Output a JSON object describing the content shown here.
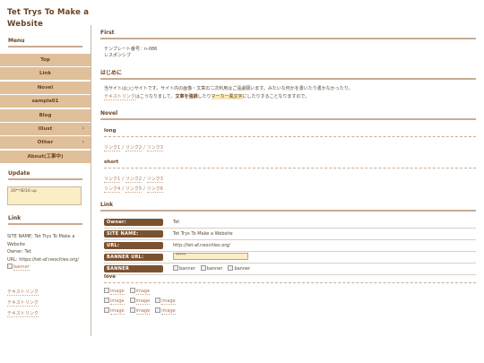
{
  "site": {
    "title": "Tet Trys To Make a Website"
  },
  "sidebar": {
    "menu_heading": "Menu",
    "menu": [
      {
        "label": "Top",
        "arrow": ""
      },
      {
        "label": "Link",
        "arrow": ""
      },
      {
        "label": "Novel",
        "arrow": ""
      },
      {
        "label": "sample01",
        "arrow": ""
      },
      {
        "label": "Blog",
        "arrow": ""
      },
      {
        "label": "Illust",
        "arrow": "›"
      },
      {
        "label": "Other",
        "arrow": "›"
      },
      {
        "label": "About(工事中)",
        "arrow": ""
      }
    ],
    "update_heading": "Update",
    "update_text": "20**/8/16 up",
    "link_heading": "Link",
    "link_info": {
      "site_name": "SITE NAME: Tet Trys To Make a Website",
      "owner": "Owner: Tet",
      "url": "URL: https://tet-af.neocities.org/",
      "banner_alt": "banner"
    },
    "text_links": [
      "テキストリンク",
      "テキストリンク",
      "テキストリンク"
    ]
  },
  "main": {
    "first": {
      "heading": "First",
      "line1": "テンプレート番号：n-086",
      "line2": "レスポンシブ"
    },
    "intro": {
      "heading": "はじめに",
      "line1": "当サイトは○○サイトです。サイト内の画像・文章の二次利用はご遠慮願います。みたいな何かを書いたり書かなかったり。",
      "p2_a": "テキストリンク",
      "p2_b": "はこうなりまして、",
      "p2_c": "文章を強調",
      "p2_d": "したり",
      "p2_e": "マーカー風文字",
      "p2_f": "にしたりすることなりますので。"
    },
    "novel": {
      "heading": "Novel",
      "long_heading": "long",
      "long_links": [
        "リンク1",
        "リンク2",
        "リンク3"
      ],
      "short_heading": "short",
      "short_links_row1": [
        "リンク1",
        "リンク2",
        "リンク3"
      ],
      "short_links_row2": [
        "リンク4",
        "リンク5",
        "リンク6"
      ],
      "separator": "/"
    },
    "link": {
      "heading": "Link",
      "rows": [
        {
          "key": "Owner:",
          "value": "Tet"
        },
        {
          "key": "SITE NAME:",
          "value": "Tet Trys To Make a Website"
        },
        {
          "key": "URL:",
          "value": "http://tet-af.neocities.org/"
        },
        {
          "key": "BANNER URL:",
          "value": "*****"
        },
        {
          "key": "BANNER",
          "value": ""
        }
      ],
      "banner_imgs": [
        "banner",
        "banner",
        "banner"
      ],
      "love_heading": "love",
      "love_rows": [
        [
          "image",
          "image"
        ],
        [
          "image",
          "image",
          "image"
        ],
        [
          "image",
          "image",
          "image"
        ]
      ]
    }
  },
  "colors": {
    "menu_bg": "#dfc09a",
    "label_bg": "#7a5230",
    "accent_text": "#6a4222",
    "link": "#b0704a",
    "marker": "#fce8b8"
  }
}
